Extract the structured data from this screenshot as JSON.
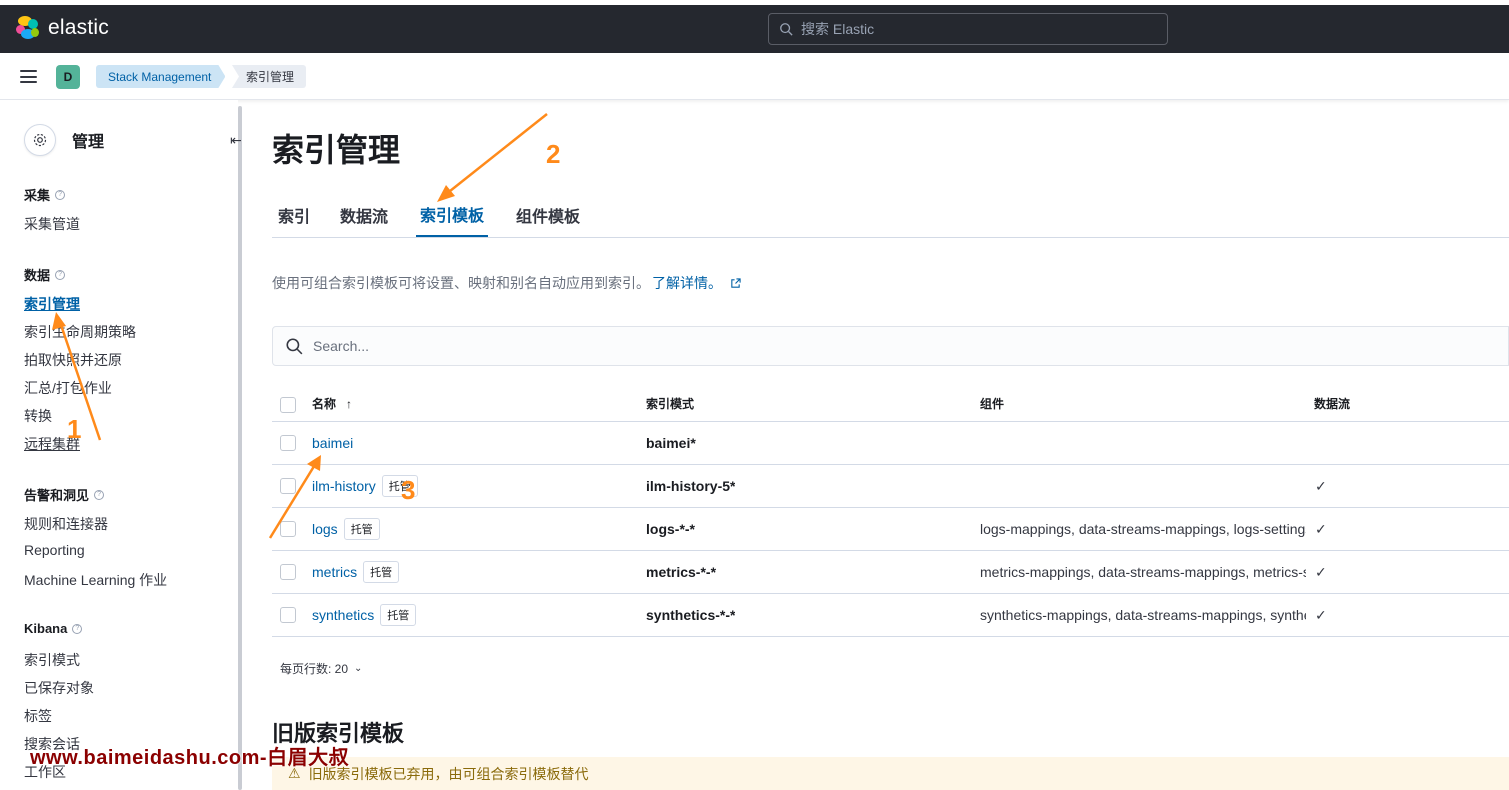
{
  "header": {
    "brand": "elastic",
    "search_placeholder": "搜索 Elastic",
    "space_initial": "D",
    "breadcrumbs": [
      "Stack Management",
      "索引管理"
    ]
  },
  "sidebar": {
    "title": "管理",
    "groups": [
      {
        "title": "采集",
        "items": [
          "采集管道"
        ]
      },
      {
        "title": "数据",
        "items": [
          "索引管理",
          "索引生命周期策略",
          "拍取快照并还原",
          "汇总/打包作业",
          "转换",
          "远程集群"
        ]
      },
      {
        "title": "告警和洞见",
        "items": [
          "规则和连接器",
          "Reporting",
          "Machine Learning 作业"
        ]
      },
      {
        "title": "Kibana",
        "items": [
          "索引模式",
          "已保存对象",
          "标签",
          "搜索会话",
          "工作区"
        ]
      }
    ],
    "active_item": "索引管理"
  },
  "main": {
    "title": "索引管理",
    "tabs": [
      "索引",
      "数据流",
      "索引模板",
      "组件模板"
    ],
    "selected_tab": "索引模板",
    "description": "使用可组合索引模板可将设置、映射和别名自动应用到索引。",
    "learn_more": "了解详情。",
    "search_placeholder": "Search...",
    "table": {
      "columns": [
        "名称",
        "索引模式",
        "组件",
        "数据流"
      ],
      "sort_indicator": "↑",
      "rows": [
        {
          "name": "baimei",
          "badge": "",
          "pattern": "baimei*",
          "components": "",
          "data_stream": false
        },
        {
          "name": "ilm-history",
          "badge": "托管",
          "pattern": "ilm-history-5*",
          "components": "",
          "data_stream": true
        },
        {
          "name": "logs",
          "badge": "托管",
          "pattern": "logs-*-*",
          "components": "logs-mappings, data-streams-mappings, logs-settings",
          "data_stream": true
        },
        {
          "name": "metrics",
          "badge": "托管",
          "pattern": "metrics-*-*",
          "components": "metrics-mappings, data-streams-mappings, metrics-settings",
          "data_stream": true
        },
        {
          "name": "synthetics",
          "badge": "托管",
          "pattern": "synthetics-*-*",
          "components": "synthetics-mappings, data-streams-mappings, synthetics-settings",
          "data_stream": true
        }
      ]
    },
    "rows_per_page": "每页行数: 20",
    "legacy_title": "旧版索引模板",
    "legacy_callout": "旧版索引模板已弃用，由可组合索引模板替代"
  },
  "annotations": {
    "labels": [
      "1",
      "2",
      "3"
    ],
    "color": "#ff8a1a",
    "watermark": "www.baimeidashu.com-白眉大叔"
  },
  "colors": {
    "accent": "#0061a6",
    "topbar": "#25282f",
    "space": "#54b399"
  }
}
